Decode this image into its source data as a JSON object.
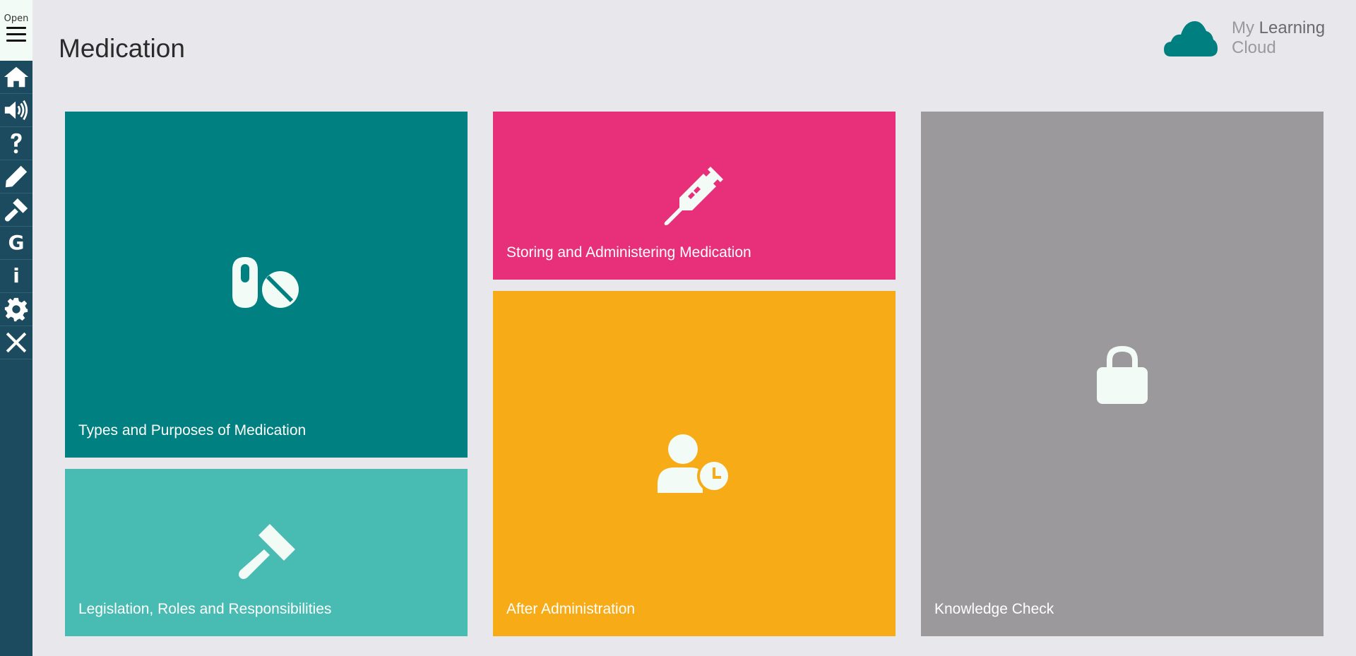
{
  "sidebar": {
    "toggle_label": "Open",
    "items": [
      {
        "name": "home-icon"
      },
      {
        "name": "audio-icon"
      },
      {
        "name": "help-icon"
      },
      {
        "name": "pencil-icon"
      },
      {
        "name": "gavel-icon"
      },
      {
        "name": "glossary-icon",
        "glyph": "G"
      },
      {
        "name": "info-icon",
        "glyph": "i"
      },
      {
        "name": "gear-icon"
      },
      {
        "name": "close-icon"
      }
    ]
  },
  "header": {
    "title": "Medication"
  },
  "logo": {
    "word1": "My",
    "word2": "Learning",
    "word3": "Cloud",
    "color": "#007f80"
  },
  "tiles": [
    {
      "label": "Types and Purposes of Medication",
      "color": "#008080",
      "icon": "pills-icon"
    },
    {
      "label": "Storing and Administering Medication",
      "color": "#e8307a",
      "icon": "syringe-icon"
    },
    {
      "label": "Knowledge Check",
      "color": "#9b999c",
      "icon": "lock-icon"
    },
    {
      "label": "Legislation, Roles and Responsibilities",
      "color": "#48bcb2",
      "icon": "gavel-icon"
    },
    {
      "label": "After Administration",
      "color": "#f6ab17",
      "icon": "user-clock-icon"
    }
  ]
}
